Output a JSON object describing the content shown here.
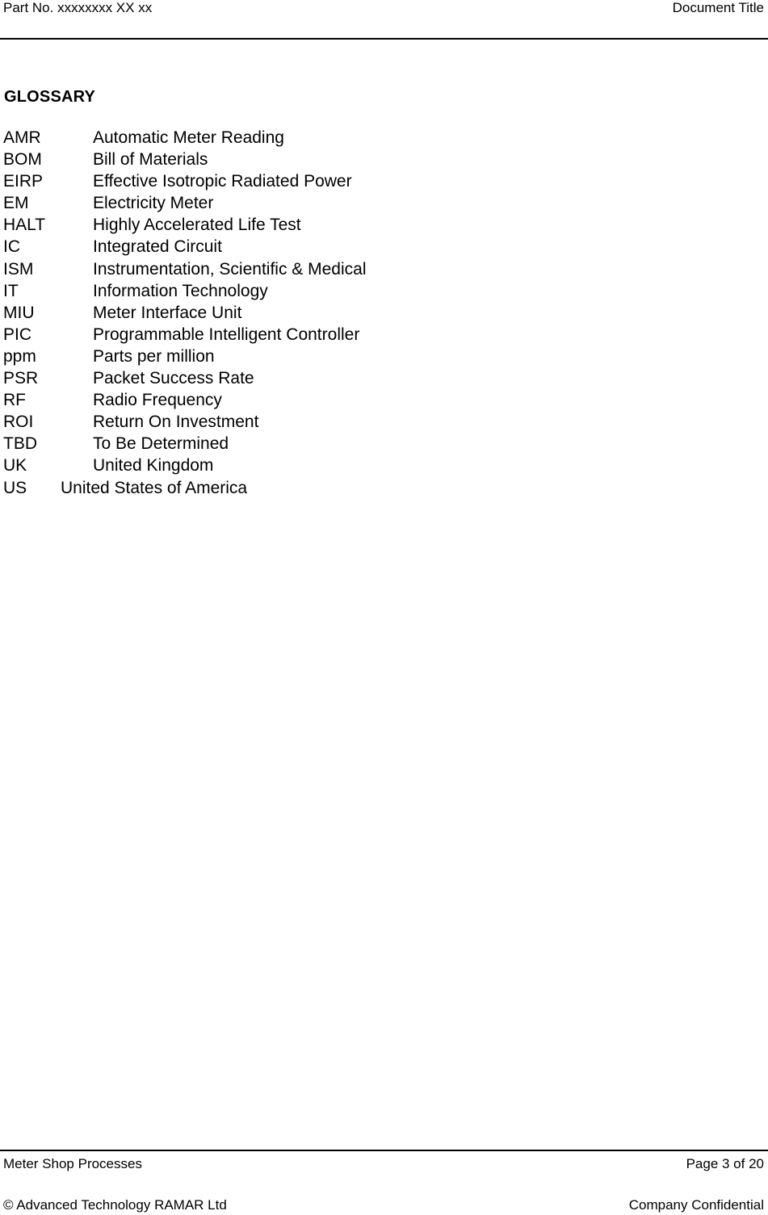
{
  "header": {
    "part_number": "Part No. xxxxxxxx XX xx",
    "document_title": "Document Title"
  },
  "section": {
    "title": "GLOSSARY"
  },
  "glossary": [
    {
      "abbr": "AMR",
      "definition": "Automatic Meter Reading"
    },
    {
      "abbr": "BOM",
      "definition": "Bill of Materials"
    },
    {
      "abbr": "EIRP",
      "definition": "Effective Isotropic Radiated Power"
    },
    {
      "abbr": "EM",
      "definition": "Electricity Meter"
    },
    {
      "abbr": "HALT",
      "definition": "Highly Accelerated Life Test"
    },
    {
      "abbr": "IC",
      "definition": "Integrated Circuit"
    },
    {
      "abbr": "ISM",
      "definition": "Instrumentation, Scientific & Medical"
    },
    {
      "abbr": "IT",
      "definition": "Information Technology"
    },
    {
      "abbr": "MIU",
      "definition": "Meter Interface Unit"
    },
    {
      "abbr": "PIC",
      "definition": "Programmable Intelligent Controller"
    },
    {
      "abbr": "ppm",
      "definition": "Parts per million"
    },
    {
      "abbr": "PSR",
      "definition": "Packet Success Rate"
    },
    {
      "abbr": "RF",
      "definition": "Radio Frequency"
    },
    {
      "abbr": "ROI",
      "definition": "Return On Investment"
    },
    {
      "abbr": "TBD",
      "definition": "To Be Determined"
    },
    {
      "abbr": "UK",
      "definition": "United Kingdom"
    },
    {
      "abbr": "US",
      "definition": "United States of America"
    }
  ],
  "footer": {
    "document_name": "Meter Shop Processes",
    "page_info": "Page 3 of 20",
    "copyright": "© Advanced Technology RAMAR Ltd",
    "classification": "Company Confidential"
  }
}
